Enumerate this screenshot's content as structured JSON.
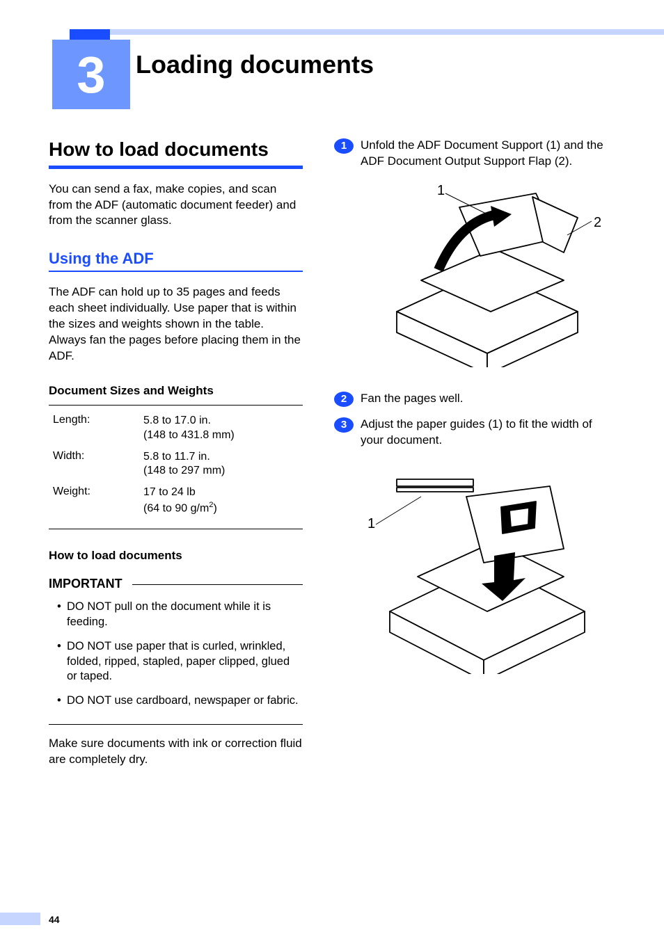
{
  "chapter_number": "3",
  "chapter_title": "Loading documents",
  "section_title": "How to load documents",
  "intro": "You can send a fax, make copies, and scan from the ADF (automatic document feeder) and from the scanner glass.",
  "sub_title": "Using the ADF",
  "adf_text": "The ADF can hold up to 35 pages and feeds each sheet individually. Use paper that is within the sizes and weights shown in the table. Always fan the pages before placing them in the ADF.",
  "spec_heading": "Document Sizes and Weights",
  "specs": {
    "length_label": "Length:",
    "length_v1": "5.8 to 17.0 in.",
    "length_v2": "(148 to 431.8 mm)",
    "width_label": "Width:",
    "width_v1": "5.8 to 11.7 in.",
    "width_v2": "(148 to 297 mm)",
    "weight_label": "Weight:",
    "weight_v1": "17 to 24 lb",
    "weight_v2a": "(64 to 90 g/m",
    "weight_v2b": ")"
  },
  "howto_heading": "How to load documents",
  "important_heading": "IMPORTANT",
  "important": {
    "i1": "DO NOT pull on the document while it is feeding.",
    "i2": "DO NOT use paper that is curled, wrinkled, folded, ripped, stapled, paper clipped, glued or taped.",
    "i3": "DO NOT use cardboard, newspaper or fabric."
  },
  "after_important": "Make sure documents with ink or correction fluid are completely dry.",
  "steps": {
    "s1": "Unfold the ADF Document Support (1) and the ADF Document Output Support Flap (2).",
    "s2": "Fan the pages well.",
    "s3": "Adjust the paper guides (1) to fit the width of your document."
  },
  "illus1": {
    "label1": "1",
    "label2": "2"
  },
  "illus2": {
    "label1": "1"
  },
  "page_number": "44"
}
